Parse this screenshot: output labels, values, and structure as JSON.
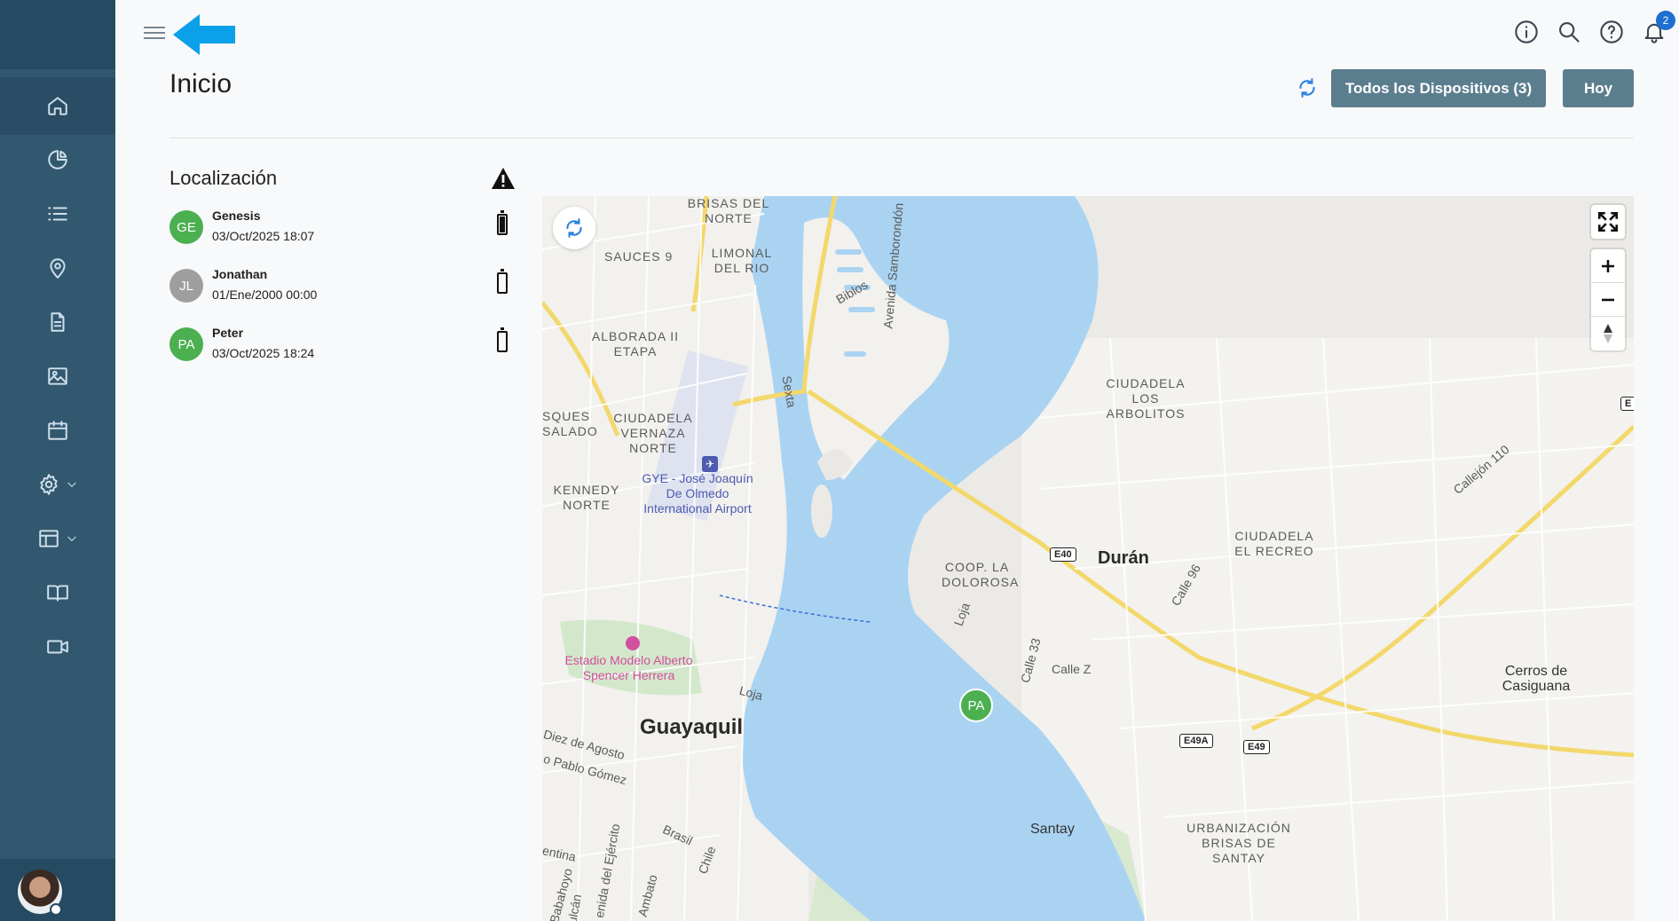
{
  "header": {
    "title": "Inicio",
    "notification_count": "2",
    "devices_button": "Todos los Dispositivos (3)",
    "today_button": "Hoy"
  },
  "sidebar": {
    "items": [
      "home-icon",
      "pie-chart-icon",
      "list-icon",
      "location-pin-icon",
      "document-icon",
      "image-icon",
      "calendar-icon",
      "gear-icon",
      "table-icon",
      "book-icon",
      "video-icon"
    ]
  },
  "location": {
    "title": "Localización",
    "devices": [
      {
        "initials": "GE",
        "name": "Genesis",
        "date": "03/Oct/2025 18:07",
        "color": "#4caf50",
        "battery": "full"
      },
      {
        "initials": "JL",
        "name": "Jonathan",
        "date": "01/Ene/2000 00:00",
        "color": "#9e9e9e",
        "battery": "empty"
      },
      {
        "initials": "PA",
        "name": "Peter",
        "date": "03/Oct/2025 18:24",
        "color": "#4caf50",
        "battery": "empty"
      }
    ]
  },
  "map": {
    "marker": "PA",
    "labels": {
      "brisas": "BRISAS DEL NORTE",
      "sauces": "SAUCES 9",
      "limonal": "LIMONAL DEL RIO",
      "alborada": "ALBORADA II ETAPA",
      "squessalado": "SQUES SALADO",
      "vernaza": "CIUDADELA VERNAZA NORTE",
      "kennedy": "KENNEDY NORTE",
      "airport": "GYE - José Joaquín De Olmedo International Airport",
      "stadium": "Estadio Modelo Alberto Spencer Herrera",
      "guayaquil": "Guayaquil",
      "duran": "Durán",
      "dolorosa": "COOP. LA DOLOROSA",
      "arbolitos": "CIUDADELA LOS ARBOLITOS",
      "recreo": "CIUDADELA EL RECREO",
      "cerros": "Cerros de Casiguana",
      "santay": "Santay",
      "urbanizacion": "URBANIZACIÓN BRISAS DE SANTAY",
      "biblos": "Biblos",
      "samborondon": "Avenida Samborondón",
      "sexta": "Sexta",
      "loja": "Loja",
      "loja2": "Loja",
      "calle33": "Calle 33",
      "callez": "Calle Z",
      "calle96": "Calle 96",
      "callejon": "Callejón 110",
      "diez": "Diez de Agosto",
      "pablo": "o Pablo Gómez",
      "brasil": "Brasil",
      "chile": "Chile",
      "ejercito": "enida del Ejército",
      "ambato": "Ambato",
      "babahoyo": "Babahoyo",
      "vulcan": "ulcán",
      "entina": "entina",
      "e40": "E40",
      "e49a": "E49A",
      "e49": "E49",
      "ecut": "E"
    }
  }
}
